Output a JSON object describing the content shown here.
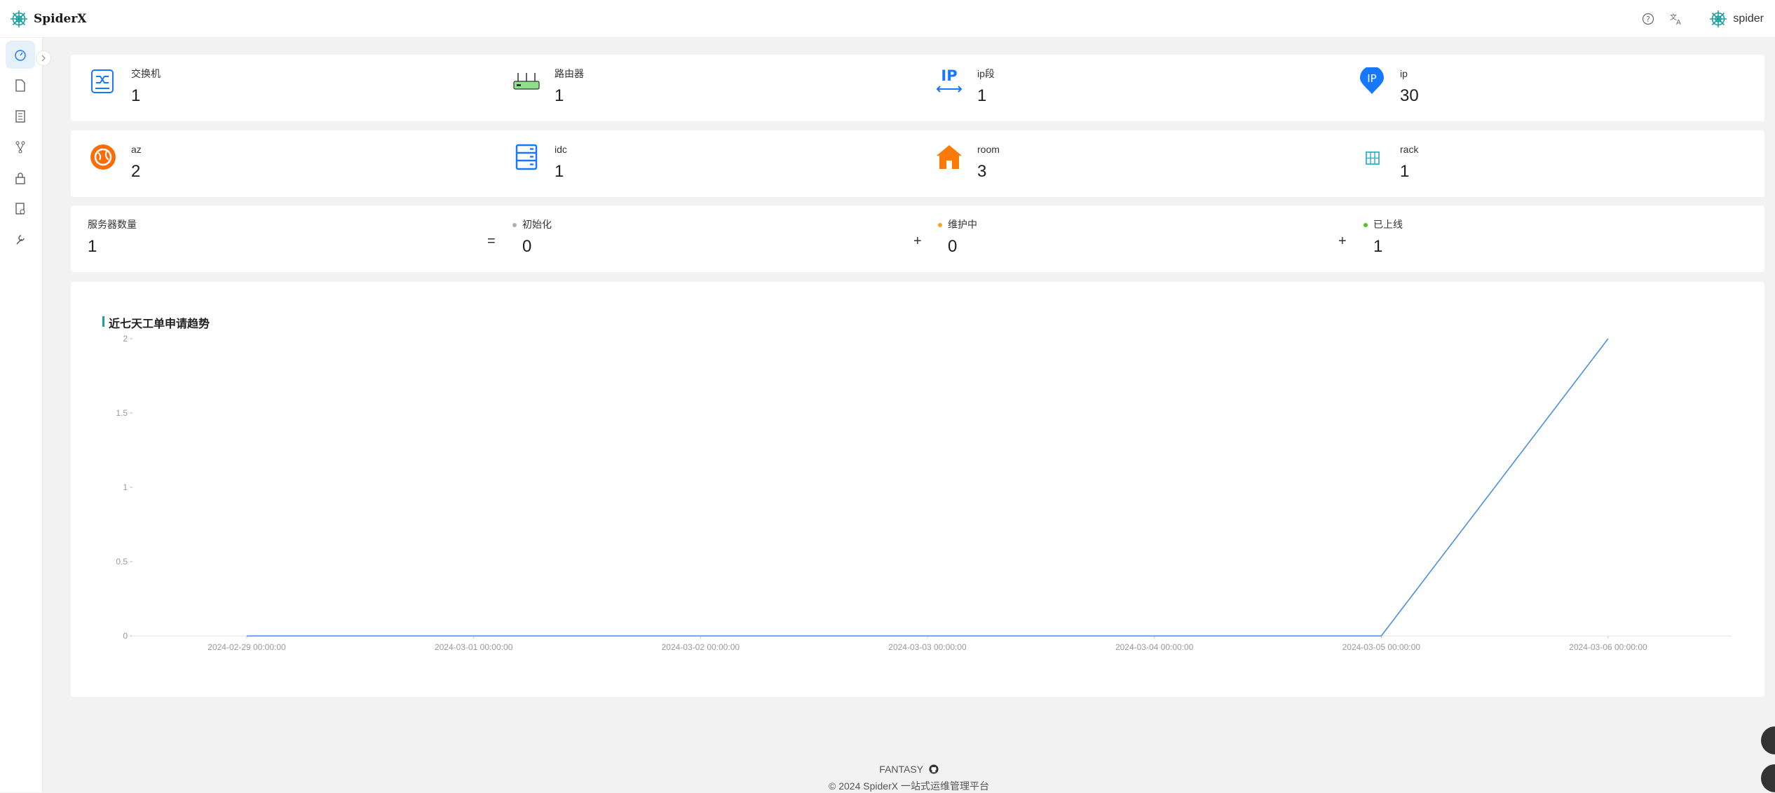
{
  "app": {
    "name": "SpiderX",
    "user": "spider"
  },
  "stats_row1": [
    {
      "label": "交换机",
      "value": "1",
      "icon": "switch-icon"
    },
    {
      "label": "路由器",
      "value": "1",
      "icon": "router-icon"
    },
    {
      "label": "ip段",
      "value": "1",
      "icon": "ip-range-icon"
    },
    {
      "label": "ip",
      "value": "30",
      "icon": "ip-pin-icon"
    }
  ],
  "stats_row2": [
    {
      "label": "az",
      "value": "2",
      "icon": "globe-icon"
    },
    {
      "label": "idc",
      "value": "1",
      "icon": "server-rack-icon"
    },
    {
      "label": "room",
      "value": "3",
      "icon": "house-icon"
    },
    {
      "label": "rack",
      "value": "1",
      "icon": "rack-icon"
    }
  ],
  "servers": {
    "total_label": "服务器数量",
    "total_value": "1",
    "eq": "=",
    "plus": "+",
    "init_label": "初始化",
    "init_value": "0",
    "maint_label": "维护中",
    "maint_value": "0",
    "online_label": "已上线",
    "online_value": "1",
    "colors": {
      "init": "#b0b0b0",
      "maint": "#f5a623",
      "online": "#52c41a"
    }
  },
  "chart_data": {
    "type": "line",
    "title": "近七天工单申请趋势",
    "categories": [
      "2024-02-29 00:00:00",
      "2024-03-01 00:00:00",
      "2024-03-02 00:00:00",
      "2024-03-03 00:00:00",
      "2024-03-04 00:00:00",
      "2024-03-05 00:00:00",
      "2024-03-06 00:00:00"
    ],
    "series": [
      {
        "values": [
          0,
          0,
          0,
          0,
          0,
          0,
          2
        ]
      }
    ],
    "yticks": [
      "0",
      "0.5",
      "1",
      "1.5",
      "2"
    ],
    "ylim": [
      0,
      2
    ],
    "grid": false,
    "color": "#4a90d9"
  },
  "footer": {
    "brand": "FANTASY",
    "copyright": "© 2024 SpiderX 一站式运维管理平台"
  },
  "colors": {
    "accent": "#1a9e9e",
    "blue": "#1677ff",
    "orange": "#fa6e0a"
  }
}
